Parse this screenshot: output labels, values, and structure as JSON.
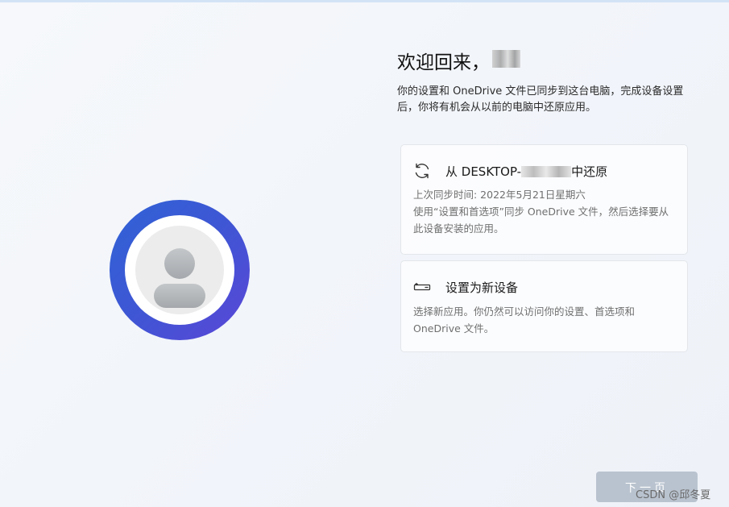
{
  "welcome": {
    "title": "欢迎回来，",
    "subtitle": "你的设置和 OneDrive 文件已同步到这台电脑，完成设备设置后，你将有机会从以前的电脑中还原应用。"
  },
  "options": {
    "restore": {
      "icon": "sync-icon",
      "title_prefix": "从 DESKTOP-",
      "title_suffix": "中还原",
      "last_sync": "上次同步时间: 2022年5月21日星期六",
      "description": "使用“设置和首选项”同步 OneDrive 文件，然后选择要从此设备安装的应用。"
    },
    "new_device": {
      "icon": "new-device-icon",
      "title": "设置为新设备",
      "description": "选择新应用。你仍然可以访问你的设置、首选项和 OneDrive 文件。"
    }
  },
  "footer": {
    "next_label": "下一页",
    "watermark": "CSDN @邱冬夏"
  },
  "colors": {
    "avatar_ring_start": "#2f63d6",
    "avatar_ring_end": "#5b46d8",
    "next_button_bg": "#b9c3cf"
  }
}
